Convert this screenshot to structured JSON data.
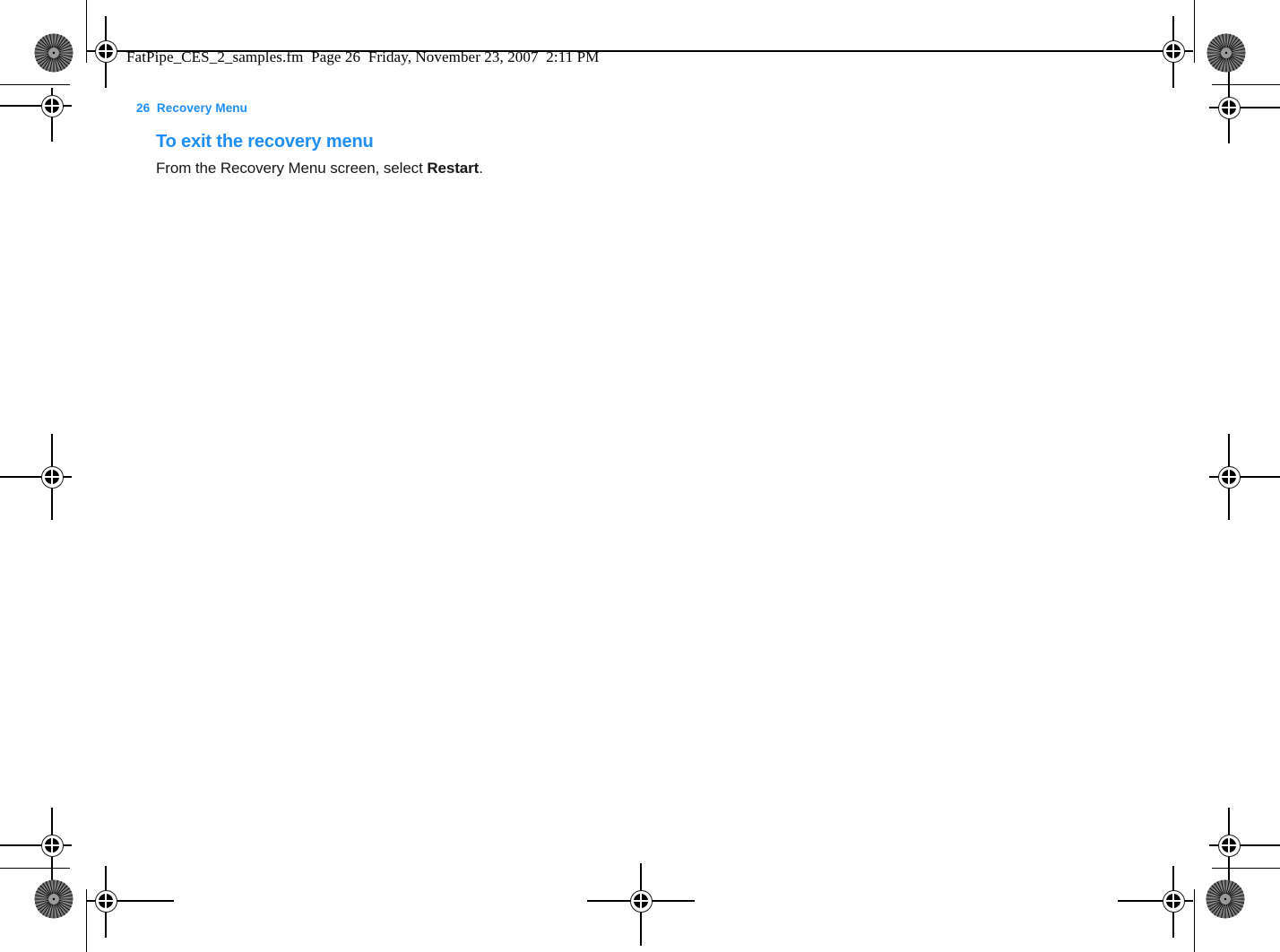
{
  "document": {
    "banner": "FatPipe_CES_2_samples.fm  Page 26  Friday, November 23, 2007  2:11 PM",
    "running_head": "26  Recovery Menu",
    "page_number": "26",
    "chapter_title": "Recovery Menu"
  },
  "content": {
    "heading": "To exit the recovery menu",
    "paragraph_prefix": "From the Recovery Menu screen, select ",
    "paragraph_bold": "Restart",
    "paragraph_suffix": "."
  },
  "colors": {
    "accent_blue": "#1d8ef4",
    "body_text": "#161616",
    "mark_black": "#000000",
    "page_background": "#ffffff"
  },
  "print_marks": {
    "registration_mark_label": "registration-target",
    "rosette_label": "color-rosette-target",
    "trim_line_label": "trim-crop-line"
  }
}
